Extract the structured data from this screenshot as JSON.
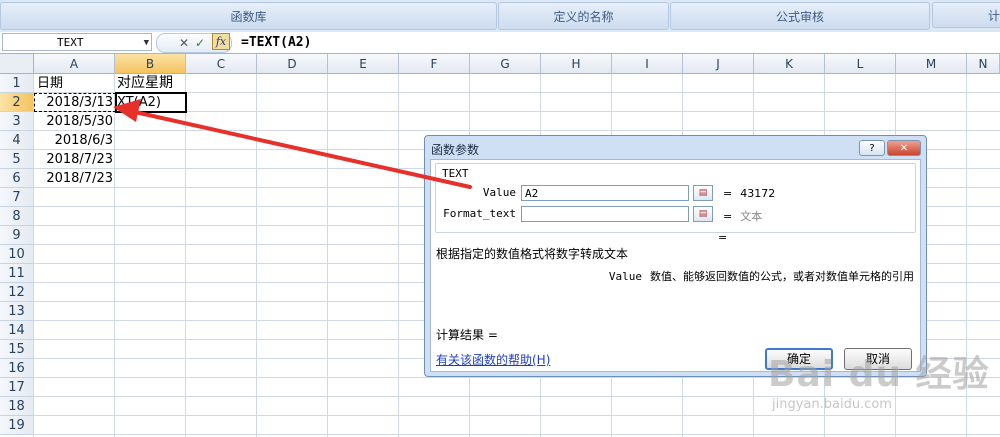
{
  "ribbon": {
    "groups": [
      "函数库",
      "定义的名称",
      "公式审核",
      "计"
    ]
  },
  "formula_bar": {
    "name_box": "TEXT",
    "dropdown": "▼",
    "cancel": "✕",
    "enter": "✓",
    "fx": "fx",
    "formula": "=TEXT(A2)"
  },
  "columns": [
    "A",
    "B",
    "C",
    "D",
    "E",
    "F",
    "G",
    "H",
    "I",
    "J",
    "K",
    "L",
    "M",
    "N"
  ],
  "rows": [
    "1",
    "2",
    "3",
    "4",
    "5",
    "6",
    "7",
    "8",
    "9",
    "10",
    "11",
    "12",
    "13",
    "14",
    "15",
    "16",
    "17",
    "18",
    "19"
  ],
  "cells": {
    "A1": "日期",
    "B1": "对应星期",
    "A2": "2018/3/13",
    "B2": "XT(A2)",
    "A3": "2018/5/30",
    "A4": "2018/6/3",
    "A5": "2018/7/23",
    "A6": "2018/7/23"
  },
  "dialog": {
    "title": "函数参数",
    "help_btn": "?",
    "close_btn": "✕",
    "function_name": "TEXT",
    "args": [
      {
        "label": "Value",
        "value": "A2",
        "result": "43172"
      },
      {
        "label": "Format_text",
        "value": "",
        "result": "文本"
      }
    ],
    "equals": "=",
    "description": "根据指定的数值格式将数字转成文本",
    "arg_desc_name": "Value",
    "arg_desc_text": "数值、能够返回数值的公式，或者对数值单元格的引用",
    "result_label": "计算结果 =",
    "help_link": "有关该函数的帮助(H)",
    "ok": "确定",
    "cancel": "取消"
  },
  "watermark": {
    "main": "Bai du 经验",
    "sub": "jingyan.baidu.com"
  },
  "colors": {
    "arrow": "#e8302a",
    "selection_header": "#f4c35f"
  }
}
